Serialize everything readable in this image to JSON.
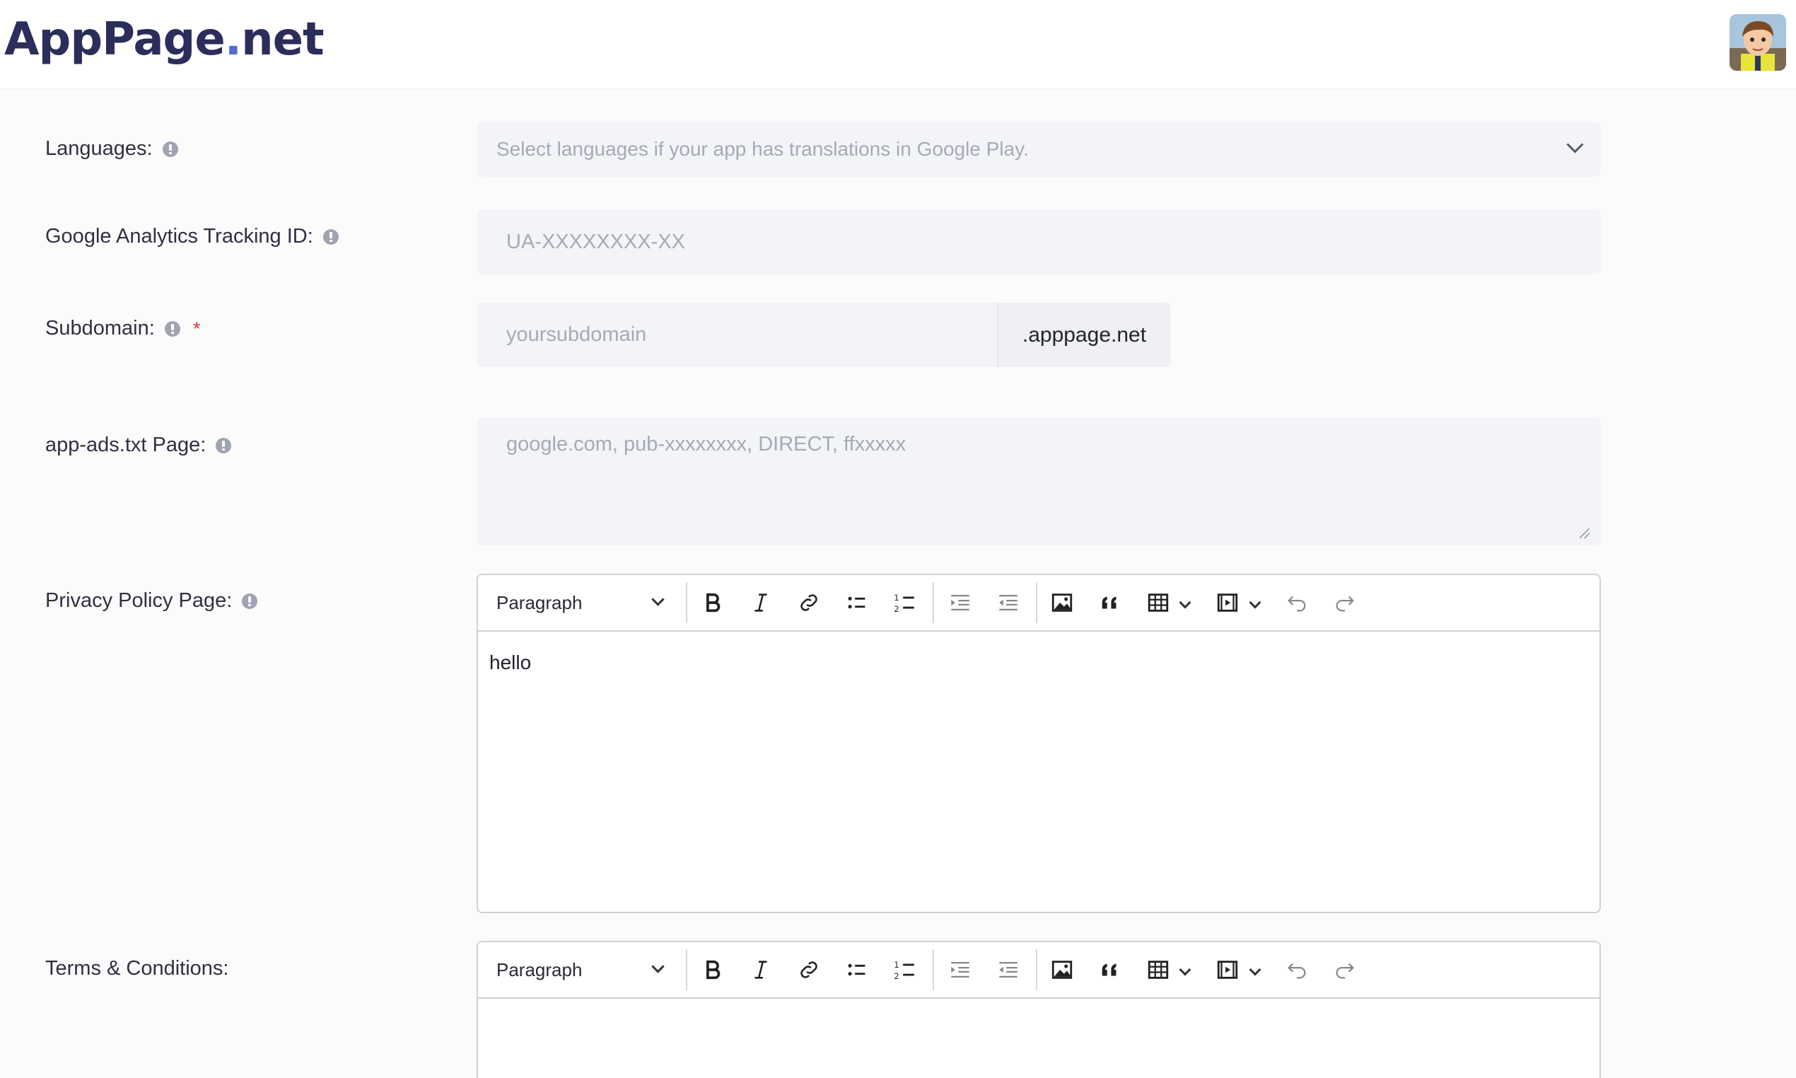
{
  "header": {
    "logo_main": "AppPage",
    "logo_dot": ".",
    "logo_tld": "net",
    "avatar_icon": "user-avatar"
  },
  "form": {
    "languages": {
      "label": "Languages:",
      "placeholder": "Select languages if your app has translations in Google Play."
    },
    "analytics": {
      "label": "Google Analytics Tracking ID:",
      "placeholder": "UA-XXXXXXXX-XX"
    },
    "subdomain": {
      "label": "Subdomain:",
      "required_mark": "*",
      "placeholder": "yoursubdomain",
      "suffix": ".apppage.net"
    },
    "app_ads": {
      "label": "app-ads.txt Page:",
      "placeholder": "google.com, pub-xxxxxxxx, DIRECT, ffxxxxx"
    },
    "privacy": {
      "label": "Privacy Policy Page:",
      "block_format": "Paragraph",
      "content": "hello"
    },
    "terms": {
      "label": "Terms & Conditions:",
      "block_format": "Paragraph",
      "content": ""
    }
  },
  "toolbar_icons": [
    "bold-icon",
    "italic-icon",
    "link-icon",
    "bulleted-list-icon",
    "numbered-list-icon",
    "indent-icon",
    "outdent-icon",
    "image-icon",
    "blockquote-icon",
    "table-icon",
    "media-icon",
    "undo-icon",
    "redo-icon"
  ]
}
